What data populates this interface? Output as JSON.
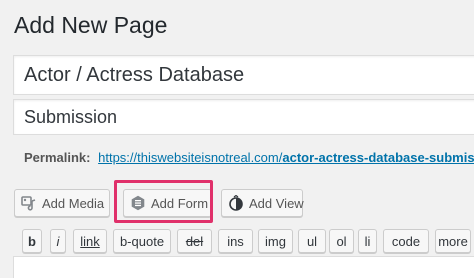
{
  "page": {
    "title": "Add New Page"
  },
  "title_field": {
    "value": "Actor / Actress Database"
  },
  "subtitle_field": {
    "value": "Submission"
  },
  "permalink": {
    "label": "Permalink:",
    "url_base": "https://thiswebsiteisnotreal.com/",
    "url_slug": "actor-actress-database-submissio"
  },
  "media_buttons": {
    "add_media": {
      "label": "Add Media",
      "icon": "media-icon"
    },
    "add_form": {
      "label": "Add Form",
      "icon": "form-icon"
    },
    "add_view": {
      "label": "Add View",
      "icon": "view-icon"
    }
  },
  "quicktags": [
    "b",
    "i",
    "link",
    "b-quote",
    "del",
    "ins",
    "img",
    "ul",
    "ol",
    "li",
    "code",
    "more"
  ],
  "colors": {
    "highlight": "#e0306a",
    "link": "#0073aa"
  }
}
